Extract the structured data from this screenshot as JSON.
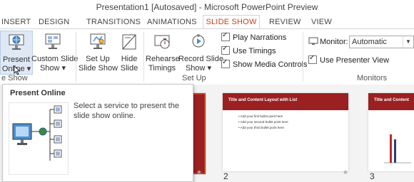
{
  "window": {
    "title": "Presentation1 [Autosaved] - Microsoft PowerPoint Preview"
  },
  "tabs": [
    {
      "label": "INSERT"
    },
    {
      "label": "DESIGN"
    },
    {
      "label": "TRANSITIONS"
    },
    {
      "label": "ANIMATIONS"
    },
    {
      "label": "SLIDE SHOW",
      "active": true
    },
    {
      "label": "REVIEW"
    },
    {
      "label": "VIEW"
    }
  ],
  "ribbon": {
    "present_online": {
      "line1": "Present",
      "line2": "Online ▾"
    },
    "custom_slide_show": {
      "line1": "Custom Slide",
      "line2": "Show ▾"
    },
    "set_up_slide_show": {
      "line1": "Set Up",
      "line2": "Slide Show"
    },
    "hide_slide": {
      "line1": "Hide",
      "line2": "Slide"
    },
    "rehearse_timings": {
      "line1": "Rehearse",
      "line2": "Timings"
    },
    "record_slide_show": {
      "line1": "Record Slide",
      "line2": "Show ▾"
    },
    "checkboxes": {
      "play_narrations": "Play Narrations",
      "use_timings": "Use Timings",
      "show_media_controls": "Show Media Controls"
    },
    "monitor": {
      "label": "Monitor:",
      "value": "Automatic"
    },
    "use_presenter_view": "Use Presenter View",
    "groups": {
      "start_slide_show_partial": "e Show",
      "set_up": "Set Up",
      "monitors": "Monitors"
    }
  },
  "tooltip": {
    "title": "Present Online",
    "description": "Select a service to present the slide show online."
  },
  "slides": [
    {
      "number": "2",
      "title": "Title and Content Layout with List",
      "bullets": [
        "Add your first bullet point here",
        "Add your second bullet point here",
        "Add your third bullet point here"
      ]
    },
    {
      "number": "3",
      "title": "Title and Content"
    }
  ],
  "colors": {
    "accent": "#c43e1c",
    "slide_header": "#9a2021",
    "chart_red": "#c0282a",
    "chart_blue": "#2c3e70"
  }
}
